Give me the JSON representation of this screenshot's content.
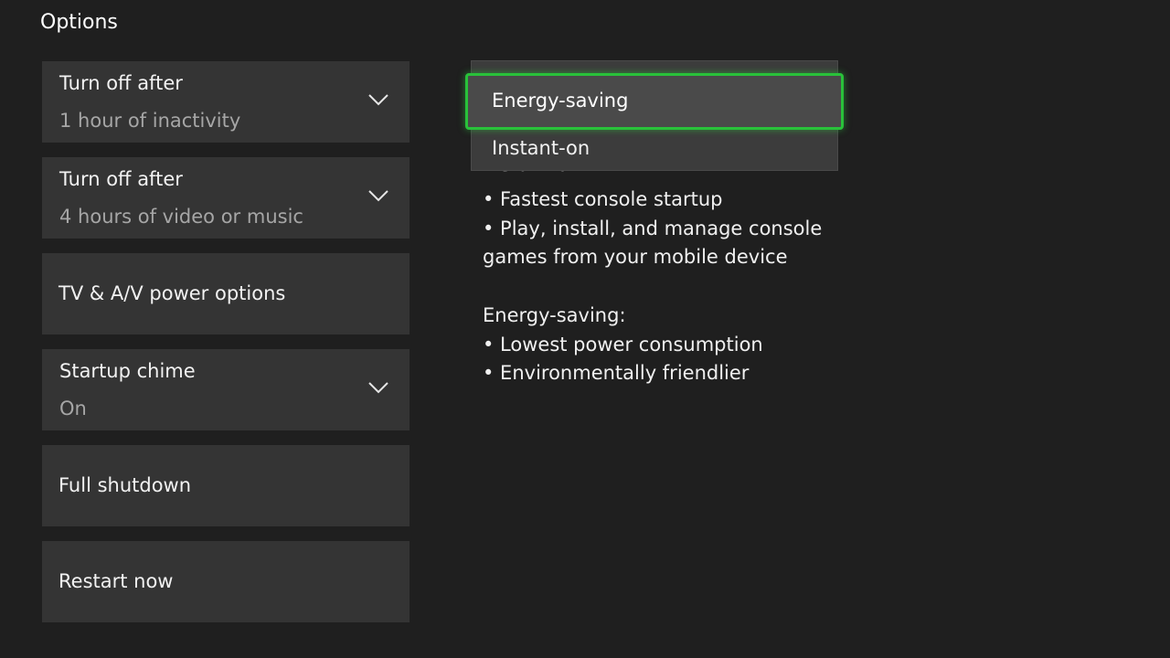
{
  "section_title": "Options",
  "tiles": [
    {
      "label": "Turn off after",
      "value": "1 hour of inactivity"
    },
    {
      "label": "Turn off after",
      "value": "4 hours of video or music"
    },
    {
      "label": "TV & A/V power options"
    },
    {
      "label": "Startup chime",
      "value": "On"
    },
    {
      "label": "Full shutdown"
    },
    {
      "label": "Restart now"
    }
  ],
  "dropdown": {
    "selected": "Energy-saving",
    "other": "Instant-on"
  },
  "description": {
    "instant_heading": "Instant-on:",
    "instant_bullets": [
      "• Fastest console startup",
      "• Play, install, and manage console",
      "games from your mobile device"
    ],
    "energy_heading": "Energy-saving:",
    "energy_bullets": [
      "• Lowest power consumption",
      "• Environmentally friendlier"
    ]
  },
  "colors": {
    "focus": "#29c13a",
    "tile": "#343434",
    "background": "#1f1f1f"
  },
  "icons": {
    "dropdown": "chevron-down-icon"
  }
}
